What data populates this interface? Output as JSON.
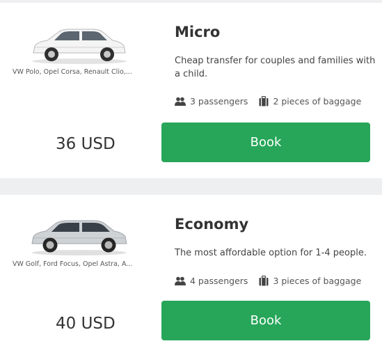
{
  "cards": [
    {
      "car_icon": "hatchback-car-image",
      "models": "VW Polo, Opel Corsa, Renault Clio,...",
      "title": "Micro",
      "description": "Cheap transfer for couples and families with a child.",
      "passengers": "3 passengers",
      "baggage": "2 pieces of baggage",
      "price": "36 USD",
      "book_label": "Book"
    },
    {
      "car_icon": "hatchback-car-image",
      "models": "VW Golf, Ford Focus, Opel Astra, A...",
      "title": "Economy",
      "description": "The most affordable option for 1-4 people.",
      "passengers": "4 passengers",
      "baggage": "3 pieces of baggage",
      "price": "40 USD",
      "book_label": "Book"
    }
  ],
  "colors": {
    "book_button": "#27a65a",
    "page_background": "#eeeff1",
    "card_background": "#ffffff"
  }
}
